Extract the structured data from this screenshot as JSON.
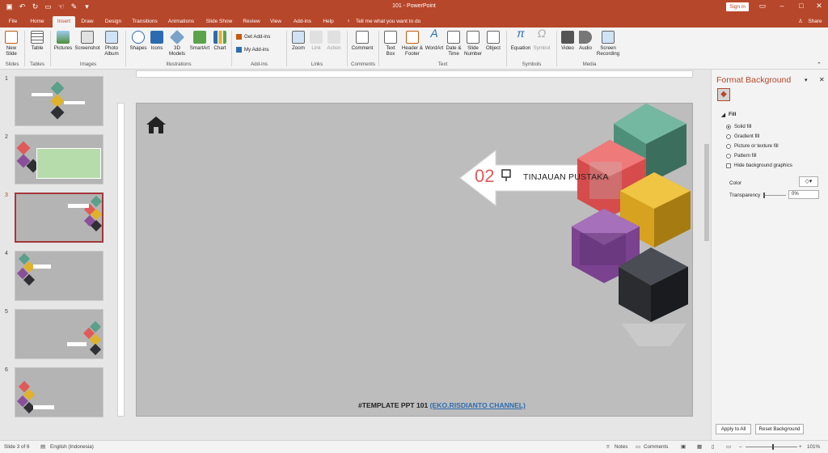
{
  "window": {
    "title": "101 - PowerPoint",
    "sign_in": "Sign in",
    "share": "Share"
  },
  "tabs": [
    "File",
    "Home",
    "Insert",
    "Draw",
    "Design",
    "Transitions",
    "Animations",
    "Slide Show",
    "Review",
    "View",
    "Add-ins",
    "Help"
  ],
  "tell_me": "Tell me what you want to do",
  "ribbon": {
    "new_slide": "New Slide",
    "table": "Table",
    "pictures": "Pictures",
    "screenshot": "Screenshot",
    "photo_album": "Photo Album",
    "shapes": "Shapes",
    "icons": "Icons",
    "models_3d": "3D Models",
    "smartart": "SmartArt",
    "chart": "Chart",
    "get_addins": "Get Add-ins",
    "my_addins": "My Add-ins",
    "zoom": "Zoom",
    "link": "Link",
    "action": "Action",
    "comment": "Comment",
    "text_box": "Text Box",
    "header_footer": "Header & Footer",
    "wordart": "WordArt",
    "date_time": "Date & Time",
    "slide_number": "Slide Number",
    "object": "Object",
    "equation": "Equation",
    "symbol": "Symbol",
    "video": "Video",
    "audio": "Audio",
    "screen_recording": "Screen Recording",
    "groups": [
      "Slides",
      "Tables",
      "Images",
      "Illustrations",
      "Add-ins",
      "Links",
      "Comments",
      "Text",
      "Symbols",
      "Media"
    ]
  },
  "thumbnails": [
    "1",
    "2",
    "3",
    "4",
    "5",
    "6"
  ],
  "slide": {
    "number_label": "02",
    "section_title": "TINJAUAN PUSTAKA",
    "footer_text": "#TEMPLATE PPT 101",
    "footer_link": "(EKO.RISDIANTO CHANNEL)"
  },
  "format_pane": {
    "title": "Format Background",
    "fill_header": "Fill",
    "solid_fill": "Solid fill",
    "gradient_fill": "Gradient fill",
    "picture_fill": "Picture or texture fill",
    "pattern_fill": "Pattern fill",
    "hide_bg": "Hide background graphics",
    "color_label": "Color",
    "transparency_label": "Transparency",
    "transparency_value": "0%",
    "apply_all": "Apply to All",
    "reset_bg": "Reset Background"
  },
  "status": {
    "slide_info": "Slide 3 of 6",
    "language": "English (Indonesia)",
    "notes": "Notes",
    "comments": "Comments",
    "zoom": "101%"
  },
  "colors": {
    "accent": "#b7472a",
    "cube_green": "#5aa08a",
    "cube_red": "#e05a5a",
    "cube_yellow": "#e0b22a",
    "cube_purple": "#8a4f9a",
    "cube_dark": "#2e3034",
    "number_red": "#e05a5a"
  }
}
